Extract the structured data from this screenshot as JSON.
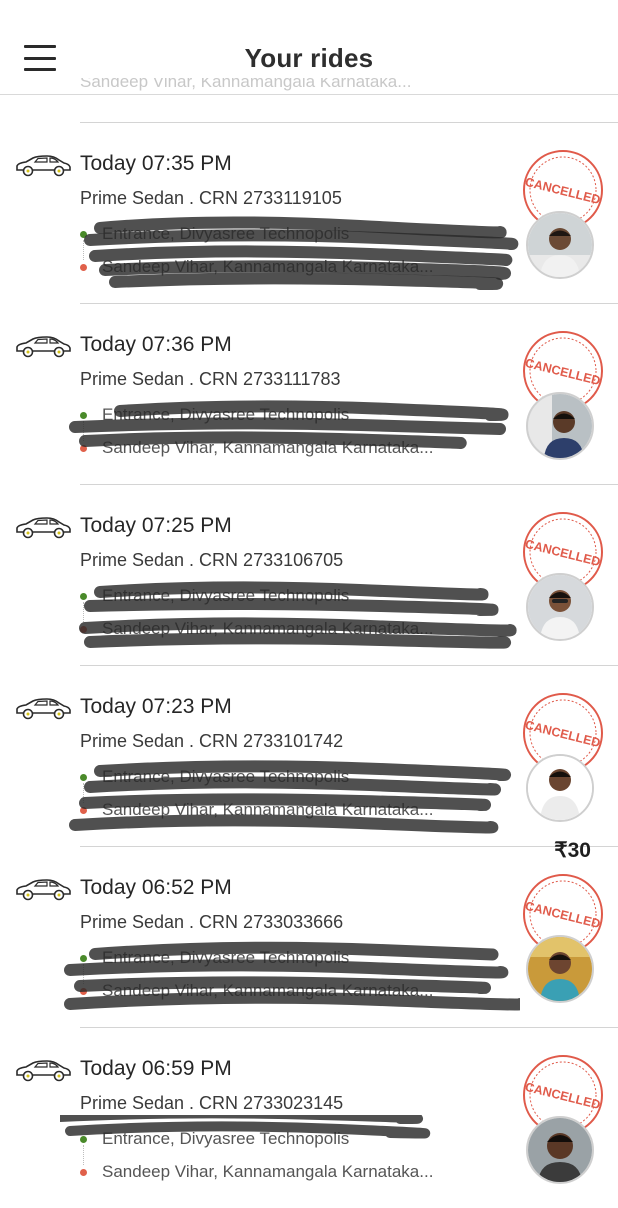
{
  "header": {
    "title": "Your rides",
    "menu_icon": "hamburger-menu-icon"
  },
  "colors": {
    "stamp_red": "#e05a4a",
    "pickup_dot": "#4a8a2a",
    "drop_dot": "#e0604a",
    "divider": "#d4d4d4"
  },
  "previous_partial": {
    "text": "Sandeep Vihar, Kannamangala Karnataka..."
  },
  "rides": [
    {
      "time": "Today 07:35 PM",
      "details": "Prime Sedan . CRN 2733119105",
      "pickup": "Entrance, Divyasree Technopolis",
      "drop": "Sandeep Vihar, Kannamangala Karnataka...",
      "status": "CANCELLED",
      "fare": ""
    },
    {
      "time": "Today 07:36 PM",
      "details": "Prime Sedan . CRN 2733111783",
      "pickup": "Entrance, Divyasree Technopolis",
      "drop": "Sandeep Vihar, Kannamangala Karnataka...",
      "status": "CANCELLED",
      "fare": ""
    },
    {
      "time": "Today 07:25 PM",
      "details": "Prime Sedan . CRN 2733106705",
      "pickup": "Entrance, Divyasree Technopolis",
      "drop": "Sandeep Vihar, Kannamangala Karnataka...",
      "status": "CANCELLED",
      "fare": ""
    },
    {
      "time": "Today 07:23 PM",
      "details": "Prime Sedan . CRN 2733101742",
      "pickup": "Entrance, Divyasree Technopolis",
      "drop": "Sandeep Vihar, Kannamangala Karnataka...",
      "status": "CANCELLED",
      "fare": ""
    },
    {
      "time": "Today 06:52 PM",
      "details": "Prime Sedan . CRN 2733033666",
      "pickup": "Entrance, Divyasree Technopolis",
      "drop": "Sandeep Vihar, Kannamangala Karnataka...",
      "status": "CANCELLED",
      "fare": "₹30"
    },
    {
      "time": "Today 06:59 PM",
      "details": "Prime Sedan . CRN 2733023145",
      "pickup": "Entrance, Divyasree Technopolis",
      "drop": "Sandeep Vihar, Kannamangala Karnataka...",
      "status": "CANCELLED",
      "fare": ""
    }
  ]
}
